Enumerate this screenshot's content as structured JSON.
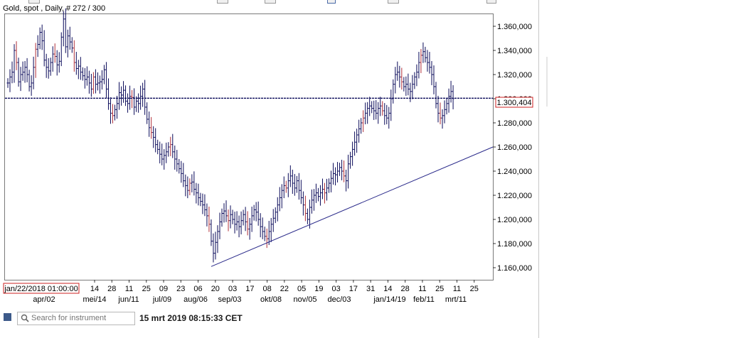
{
  "header": {
    "title": "Gold, spot , Daily, # 272 / 300"
  },
  "colors": {
    "bar_color": "#0b0b5a",
    "bar_accent": "#b0303a",
    "reference_line": "#0b0b5a",
    "trend_line": "#2a2a8a",
    "price_box_border": "#cc2222"
  },
  "footer": {
    "search_placeholder": "Search for instrument",
    "timestamp": "15 mrt 2019 08:15:33 CET",
    "square_icon": "square-icon",
    "search_icon": "search-icon"
  },
  "chart_data": {
    "type": "ohlc",
    "title": "Gold, spot , Daily, # 272 / 300",
    "ylim": [
      1.15,
      1.37
    ],
    "y_ticks": [
      {
        "v": 1.16,
        "label": "1.160,000"
      },
      {
        "v": 1.18,
        "label": "1.180,000"
      },
      {
        "v": 1.2,
        "label": "1.200,000"
      },
      {
        "v": 1.22,
        "label": "1.220,000"
      },
      {
        "v": 1.24,
        "label": "1.240,000"
      },
      {
        "v": 1.26,
        "label": "1.260,000"
      },
      {
        "v": 1.28,
        "label": "1.280,000"
      },
      {
        "v": 1.3,
        "label": "1.300,000"
      },
      {
        "v": 1.32,
        "label": "1.320,000"
      },
      {
        "v": 1.34,
        "label": "1.340,000"
      },
      {
        "v": 1.36,
        "label": "1.360,000"
      }
    ],
    "x_first_bar_label": "jan/22/2018 01:00:00",
    "x_day_ticks": [
      "14",
      "28",
      "11",
      "25",
      "09",
      "23",
      "06",
      "20",
      "03",
      "17",
      "08",
      "22",
      "05",
      "19",
      "03",
      "17",
      "31",
      "14",
      "28",
      "11",
      "25",
      "11",
      "25"
    ],
    "x_month_labels": [
      "apr/02",
      "mei/14",
      "jun/11",
      "jul/09",
      "aug/06",
      "sep/03",
      "okt/08",
      "nov/05",
      "dec/03",
      "jan/14/19",
      "feb/11",
      "mrt/11"
    ],
    "current_price": 1.300404,
    "current_price_label": "1.300,404",
    "trend_line": {
      "start_value": 1.161,
      "end_value": 1.26
    },
    "series": [
      {
        "name": "",
        "closes": [
          1.313,
          1.318,
          1.322,
          1.34,
          1.33,
          1.314,
          1.32,
          1.322,
          1.326,
          1.32,
          1.31,
          1.313,
          1.326,
          1.341,
          1.345,
          1.355,
          1.348,
          1.332,
          1.326,
          1.323,
          1.33,
          1.337,
          1.335,
          1.328,
          1.331,
          1.351,
          1.366,
          1.343,
          1.352,
          1.347,
          1.342,
          1.33,
          1.325,
          1.327,
          1.322,
          1.319,
          1.316,
          1.318,
          1.313,
          1.308,
          1.318,
          1.312,
          1.313,
          1.314,
          1.316,
          1.324,
          1.308,
          1.296,
          1.288,
          1.286,
          1.291,
          1.296,
          1.305,
          1.303,
          1.307,
          1.298,
          1.296,
          1.302,
          1.301,
          1.293,
          1.298,
          1.296,
          1.302,
          1.308,
          1.293,
          1.283,
          1.276,
          1.272,
          1.268,
          1.262,
          1.258,
          1.254,
          1.25,
          1.253,
          1.256,
          1.26,
          1.262,
          1.256,
          1.25,
          1.246,
          1.242,
          1.238,
          1.232,
          1.228,
          1.224,
          1.23,
          1.231,
          1.225,
          1.222,
          1.218,
          1.215,
          1.212,
          1.208,
          1.203,
          1.196,
          1.182,
          1.172,
          1.181,
          1.19,
          1.198,
          1.205,
          1.207,
          1.203,
          1.199,
          1.204,
          1.2,
          1.196,
          1.198,
          1.194,
          1.199,
          1.204,
          1.198,
          1.192,
          1.196,
          1.203,
          1.208,
          1.206,
          1.2,
          1.194,
          1.19,
          1.186,
          1.184,
          1.19,
          1.196,
          1.201,
          1.206,
          1.212,
          1.218,
          1.224,
          1.228,
          1.226,
          1.232,
          1.236,
          1.23,
          1.226,
          1.232,
          1.224,
          1.218,
          1.212,
          1.205,
          1.2,
          1.21,
          1.216,
          1.22,
          1.222,
          1.219,
          1.222,
          1.225,
          1.222,
          1.226,
          1.23,
          1.234,
          1.238,
          1.237,
          1.24,
          1.243,
          1.24,
          1.236,
          1.232,
          1.246,
          1.252,
          1.258,
          1.264,
          1.27,
          1.275,
          1.28,
          1.284,
          1.288,
          1.292,
          1.294,
          1.292,
          1.29,
          1.288,
          1.292,
          1.294,
          1.29,
          1.286,
          1.284,
          1.288,
          1.3,
          1.312,
          1.32,
          1.322,
          1.318,
          1.314,
          1.31,
          1.312,
          1.308,
          1.306,
          1.312,
          1.318,
          1.322,
          1.33,
          1.336,
          1.339,
          1.334,
          1.33,
          1.326,
          1.32,
          1.31,
          1.296,
          1.288,
          1.284,
          1.286,
          1.291,
          1.296,
          1.302,
          1.306,
          1.3
        ]
      }
    ]
  }
}
